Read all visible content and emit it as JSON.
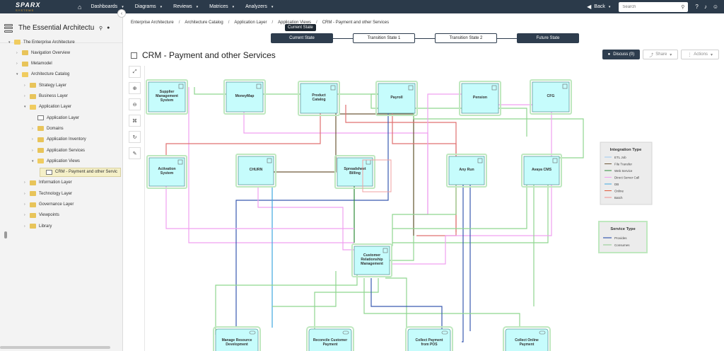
{
  "app": {
    "logo_main": "SPARX",
    "logo_sub": "SYSTEMS",
    "nav": [
      "Dashboards",
      "Diagrams",
      "Reviews",
      "Matrices",
      "Analyzers"
    ],
    "back_label": "Back",
    "search_placeholder": "Search"
  },
  "sidebar": {
    "title": "The Essential Architectu...",
    "tree": [
      {
        "label": "The Enterprise Architecture",
        "level": 0,
        "expanded": true,
        "kind": "folder"
      },
      {
        "label": "Navigation Overview",
        "level": 1,
        "expanded": false,
        "kind": "folder"
      },
      {
        "label": "Metamodel",
        "level": 1,
        "expanded": false,
        "kind": "folder"
      },
      {
        "label": "Architecture Catalog",
        "level": 1,
        "expanded": true,
        "kind": "folder"
      },
      {
        "label": "Strategy Layer",
        "level": 2,
        "expanded": false,
        "kind": "folder"
      },
      {
        "label": "Business Layer",
        "level": 2,
        "expanded": false,
        "kind": "folder"
      },
      {
        "label": "Application Layer",
        "level": 2,
        "expanded": true,
        "kind": "folder"
      },
      {
        "label": "Application Layer",
        "level": 3,
        "expanded": false,
        "kind": "diagram"
      },
      {
        "label": "Domains",
        "level": 3,
        "expanded": false,
        "kind": "folder"
      },
      {
        "label": "Application Inventory",
        "level": 3,
        "expanded": false,
        "kind": "folder"
      },
      {
        "label": "Application Services",
        "level": 3,
        "expanded": false,
        "kind": "folder"
      },
      {
        "label": "Application Views",
        "level": 3,
        "expanded": true,
        "kind": "folder"
      },
      {
        "label": "CRM - Payment and other Servic",
        "level": 4,
        "expanded": false,
        "kind": "diagram",
        "selected": true
      },
      {
        "label": "Information Layer",
        "level": 2,
        "expanded": false,
        "kind": "folder"
      },
      {
        "label": "Technology Layer",
        "level": 2,
        "expanded": false,
        "kind": "folder"
      },
      {
        "label": "Governance Layer",
        "level": 2,
        "expanded": false,
        "kind": "folder"
      },
      {
        "label": "Viewpoints",
        "level": 2,
        "expanded": false,
        "kind": "folder"
      },
      {
        "label": "Library",
        "level": 2,
        "expanded": false,
        "kind": "folder"
      }
    ]
  },
  "breadcrumb": [
    "Enterprise Architecture",
    "Architecture Catalog",
    "Application Layer",
    "Application Views",
    "CRM - Payment and other Services"
  ],
  "states": {
    "tooltip": "Current State",
    "items": [
      "Current State",
      "Transition State 1",
      "Transition State 2",
      "Future State"
    ]
  },
  "page_title": "CRM - Payment and other Services",
  "actions": {
    "discuss": "Discuss (0)",
    "share": "Share",
    "actions": "Actions"
  },
  "diagram": {
    "top_nodes": [
      "Supplier Management System",
      "MoneyMap",
      "Product Catalog",
      "Payroll",
      "Pension",
      "CFG"
    ],
    "mid_nodes": [
      "Activation System",
      "CHURN",
      "Spreadsheet Billing",
      "Any Run",
      "Avaya CMS"
    ],
    "center_node": "Customer Relationship Management",
    "bottom_nodes": [
      "Manage Resource Development",
      "Reconcile Customer Payment",
      "Collect Payment from POS",
      "Collect Online Payment"
    ],
    "legend_integration": {
      "title": "Integration Type",
      "items": [
        {
          "label": "ETL Job",
          "color": "#9ec8f0"
        },
        {
          "label": "File Transfer",
          "color": "#6f5a3a"
        },
        {
          "label": "Web Service",
          "color": "#2e8b3a"
        },
        {
          "label": "Direct Server Call",
          "color": "#f0a0f0"
        },
        {
          "label": "DB",
          "color": "#40a8e0"
        },
        {
          "label": "Online",
          "color": "#e05a3a"
        },
        {
          "label": "Batch",
          "color": "#f09090"
        }
      ]
    },
    "legend_service": {
      "title": "Service Type",
      "items": [
        {
          "label": "Provides",
          "color": "#3a5ab0"
        },
        {
          "label": "Consumes",
          "color": "#9ed09e"
        }
      ]
    }
  }
}
